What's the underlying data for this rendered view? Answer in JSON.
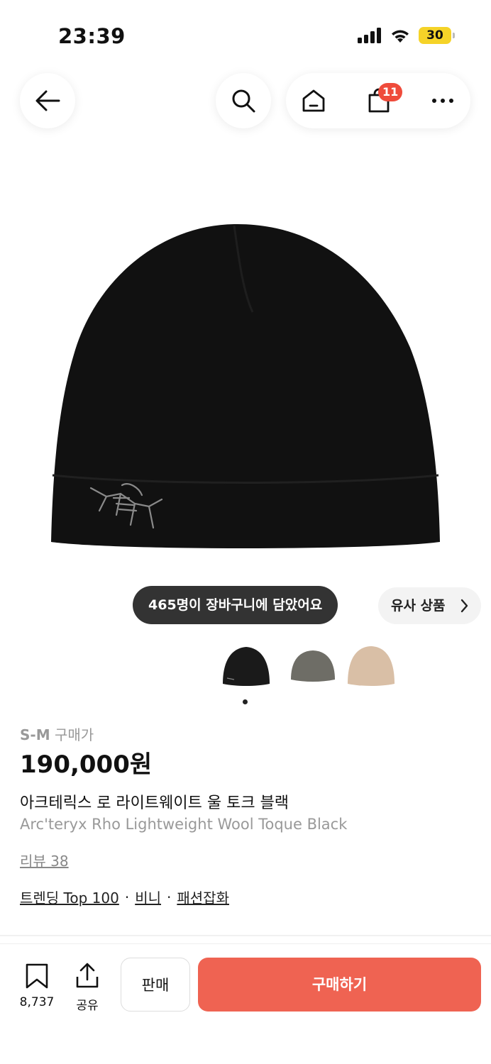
{
  "status_bar": {
    "time": "23:39",
    "battery": "30"
  },
  "nav": {
    "cart_badge": "11"
  },
  "chips": {
    "cart_count": "465명이 장바구니에 담았어요",
    "similar": "유사 상품"
  },
  "product": {
    "size_label": "S-M",
    "price_label": "구매가",
    "price": "190,000원",
    "name_ko": "아크테릭스 로 라이트웨이트 울 토크 블랙",
    "name_en": "Arc'teryx Rho Lightweight Wool Toque Black",
    "review": "리뷰 38",
    "tags": [
      "트렌딩 Top 100",
      "비니",
      "패션잡화"
    ],
    "tag_separator": "·"
  },
  "thumbnails": [
    {
      "color": "#1a1a1a",
      "name": "black"
    },
    {
      "color": "#6e6d66",
      "name": "grey"
    },
    {
      "color": "#d9bfa6",
      "name": "beige"
    }
  ],
  "bottom_bar": {
    "bookmark_count": "8,737",
    "share_label": "공유",
    "sell_label": "판매",
    "buy_label": "구매하기"
  },
  "colors": {
    "accent": "#ef6352",
    "badge": "#ef4b3b",
    "battery": "#f5d328"
  }
}
